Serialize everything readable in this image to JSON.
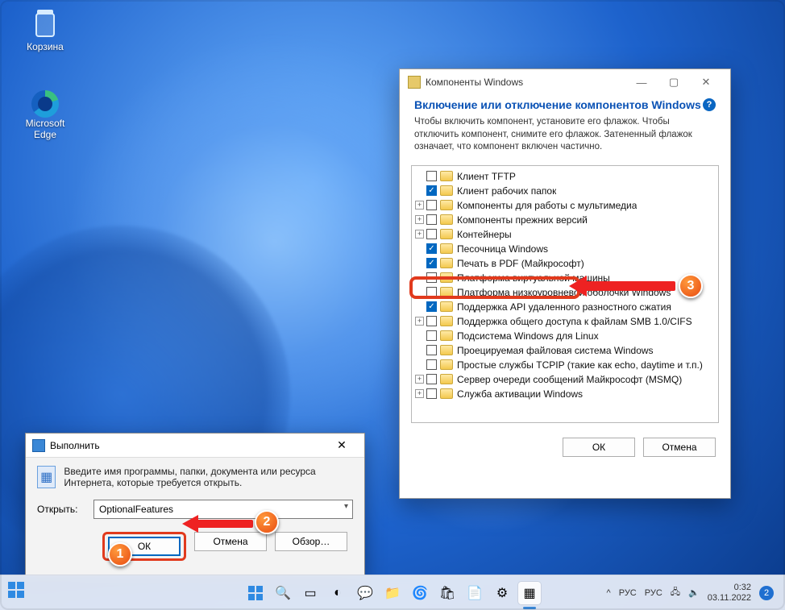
{
  "desktop": {
    "icons": [
      {
        "name": "recycle-bin",
        "label": "Корзина"
      },
      {
        "name": "edge",
        "label": "Microsoft Edge"
      }
    ]
  },
  "run_dialog": {
    "title": "Выполнить",
    "description": "Введите имя программы, папки, документа или ресурса Интернета, которые требуется открыть.",
    "open_label": "Открыть:",
    "open_value": "OptionalFeatures",
    "buttons": {
      "ok": "ОК",
      "cancel": "Отмена",
      "browse": "Обзор…"
    }
  },
  "features_dialog": {
    "title": "Компоненты Windows",
    "heading": "Включение или отключение компонентов Windows",
    "description": "Чтобы включить компонент, установите его флажок. Чтобы отключить компонент, снимите его флажок. Затененный флажок означает, что компонент включен частично.",
    "items": [
      {
        "label": "Клиент TFTP",
        "checked": false,
        "expander": ""
      },
      {
        "label": "Клиент рабочих папок",
        "checked": true,
        "expander": ""
      },
      {
        "label": "Компоненты для работы с мультимедиа",
        "checked": false,
        "expander": "+"
      },
      {
        "label": "Компоненты прежних версий",
        "checked": false,
        "expander": "+"
      },
      {
        "label": "Контейнеры",
        "checked": false,
        "expander": "+"
      },
      {
        "label": "Песочница Windows",
        "checked": true,
        "expander": ""
      },
      {
        "label": "Печать в PDF (Майкрософт)",
        "checked": true,
        "expander": ""
      },
      {
        "label": "Платформа виртуальной машины",
        "checked": false,
        "expander": ""
      },
      {
        "label": "Платформа низкоуровневой оболочки Windows",
        "checked": false,
        "expander": ""
      },
      {
        "label": "Поддержка API удаленного разностного сжатия",
        "checked": true,
        "expander": ""
      },
      {
        "label": "Поддержка общего доступа к файлам SMB 1.0/CIFS",
        "checked": false,
        "expander": "+"
      },
      {
        "label": "Подсистема Windows для Linux",
        "checked": false,
        "expander": ""
      },
      {
        "label": "Проецируемая файловая система Windows",
        "checked": false,
        "expander": ""
      },
      {
        "label": "Простые службы TCPIP (такие как echo, daytime и т.п.)",
        "checked": false,
        "expander": ""
      },
      {
        "label": "Сервер очереди сообщений Майкрософт (MSMQ)",
        "checked": false,
        "expander": "+"
      },
      {
        "label": "Служба активации Windows",
        "checked": false,
        "expander": "+"
      }
    ],
    "buttons": {
      "ok": "ОК",
      "cancel": "Отмена"
    }
  },
  "annotations": {
    "b1": "1",
    "b2": "2",
    "b3": "3"
  },
  "taskbar": {
    "tray": {
      "lang1": "РУС",
      "lang2": "РУС",
      "time": "0:32",
      "date": "03.11.2022",
      "notif": "2"
    },
    "chevron": "^"
  }
}
